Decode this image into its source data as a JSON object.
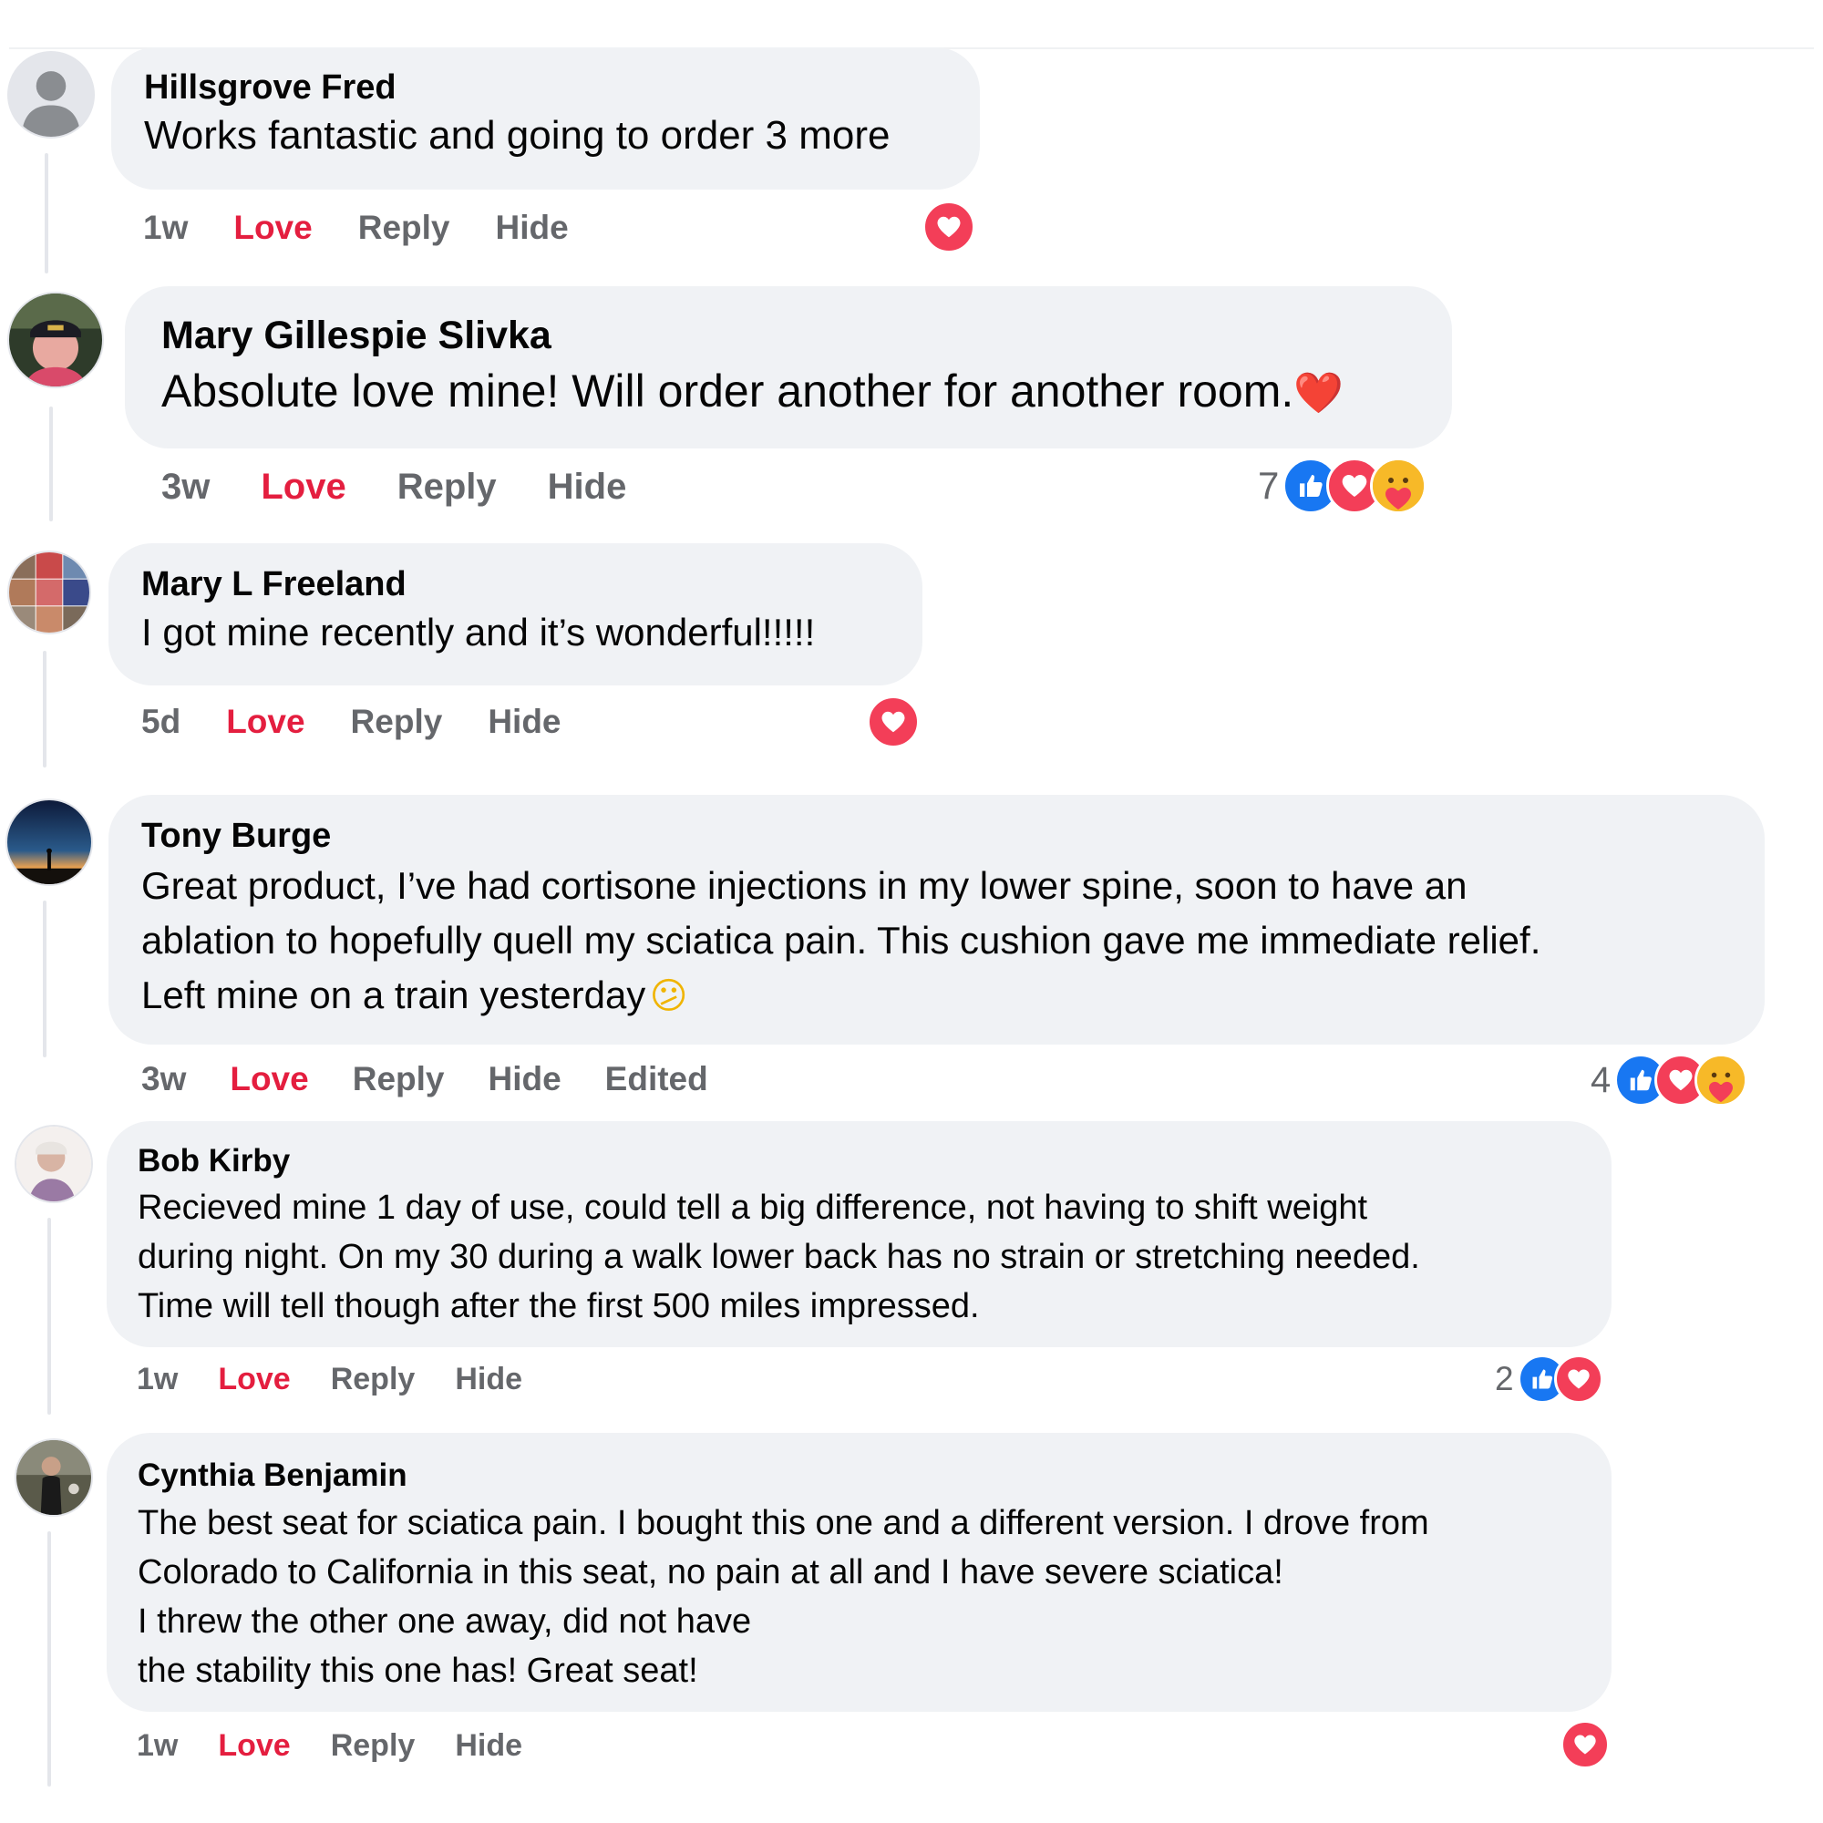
{
  "comments": [
    {
      "author": "Hillsgrove Fred",
      "text": "Works fantastic and going to order 3 more",
      "time": "1w",
      "actions": {
        "love": "Love",
        "reply": "Reply",
        "hide": "Hide",
        "edited": ""
      },
      "reactions": {
        "count": "",
        "icons": [
          "love-icon"
        ]
      },
      "avatar": "default-avatar-icon"
    },
    {
      "author": "Mary Gillespie Slivka",
      "text": "Absolute love mine! Will order another for another room.",
      "emoji": "❤️",
      "time": "3w",
      "actions": {
        "love": "Love",
        "reply": "Reply",
        "hide": "Hide",
        "edited": ""
      },
      "reactions": {
        "count": "7",
        "icons": [
          "like-icon",
          "love-icon",
          "care-icon"
        ]
      },
      "avatar": "profile-photo"
    },
    {
      "author": "Mary L Freeland",
      "text": "I got mine recently and it’s wonderful!!!!!",
      "time": "5d",
      "actions": {
        "love": "Love",
        "reply": "Reply",
        "hide": "Hide",
        "edited": ""
      },
      "reactions": {
        "count": "",
        "icons": [
          "love-icon"
        ]
      },
      "avatar": "profile-collage"
    },
    {
      "author": "Tony Burge",
      "text": "Great product, I’ve had cortisone injections in my lower spine, soon to have an\nablation to hopefully quell my sciatica pain. This cushion gave me immediate relief.\nLeft mine on a train yesterday",
      "emoji": "😕",
      "time": "3w",
      "actions": {
        "love": "Love",
        "reply": "Reply",
        "hide": "Hide",
        "edited": "Edited"
      },
      "reactions": {
        "count": "4",
        "icons": [
          "like-icon",
          "love-icon",
          "care-icon"
        ]
      },
      "avatar": "sunset-photo"
    },
    {
      "author": "Bob Kirby",
      "text": "Recieved mine 1 day of use, could tell a big difference, not having to shift weight\nduring night. On my 30 during a walk lower back has no strain or stretching needed.\nTime will tell though after the first 500 miles impressed.",
      "time": "1w",
      "actions": {
        "love": "Love",
        "reply": "Reply",
        "hide": "Hide",
        "edited": ""
      },
      "reactions": {
        "count": "2",
        "icons": [
          "like-icon",
          "love-icon"
        ]
      },
      "avatar": "profile-photo"
    },
    {
      "author": "Cynthia Benjamin",
      "text": "The best seat for sciatica pain. I bought this one and a different version. I drove from\nColorado to California in this seat, no pain at all and I have severe sciatica!\nI threw the other one away, did not have\nthe stability this one has! Great seat!",
      "time": "1w",
      "actions": {
        "love": "Love",
        "reply": "Reply",
        "hide": "Hide",
        "edited": ""
      },
      "reactions": {
        "count": "",
        "icons": [
          "love-icon"
        ]
      },
      "avatar": "profile-photo"
    }
  ],
  "colors": {
    "bubble": "#f0f2f5",
    "love_text": "#e41e3f",
    "meta_text": "#65676b",
    "like": "#1877f2",
    "love": "#f33e58",
    "care": "#f7b928"
  }
}
